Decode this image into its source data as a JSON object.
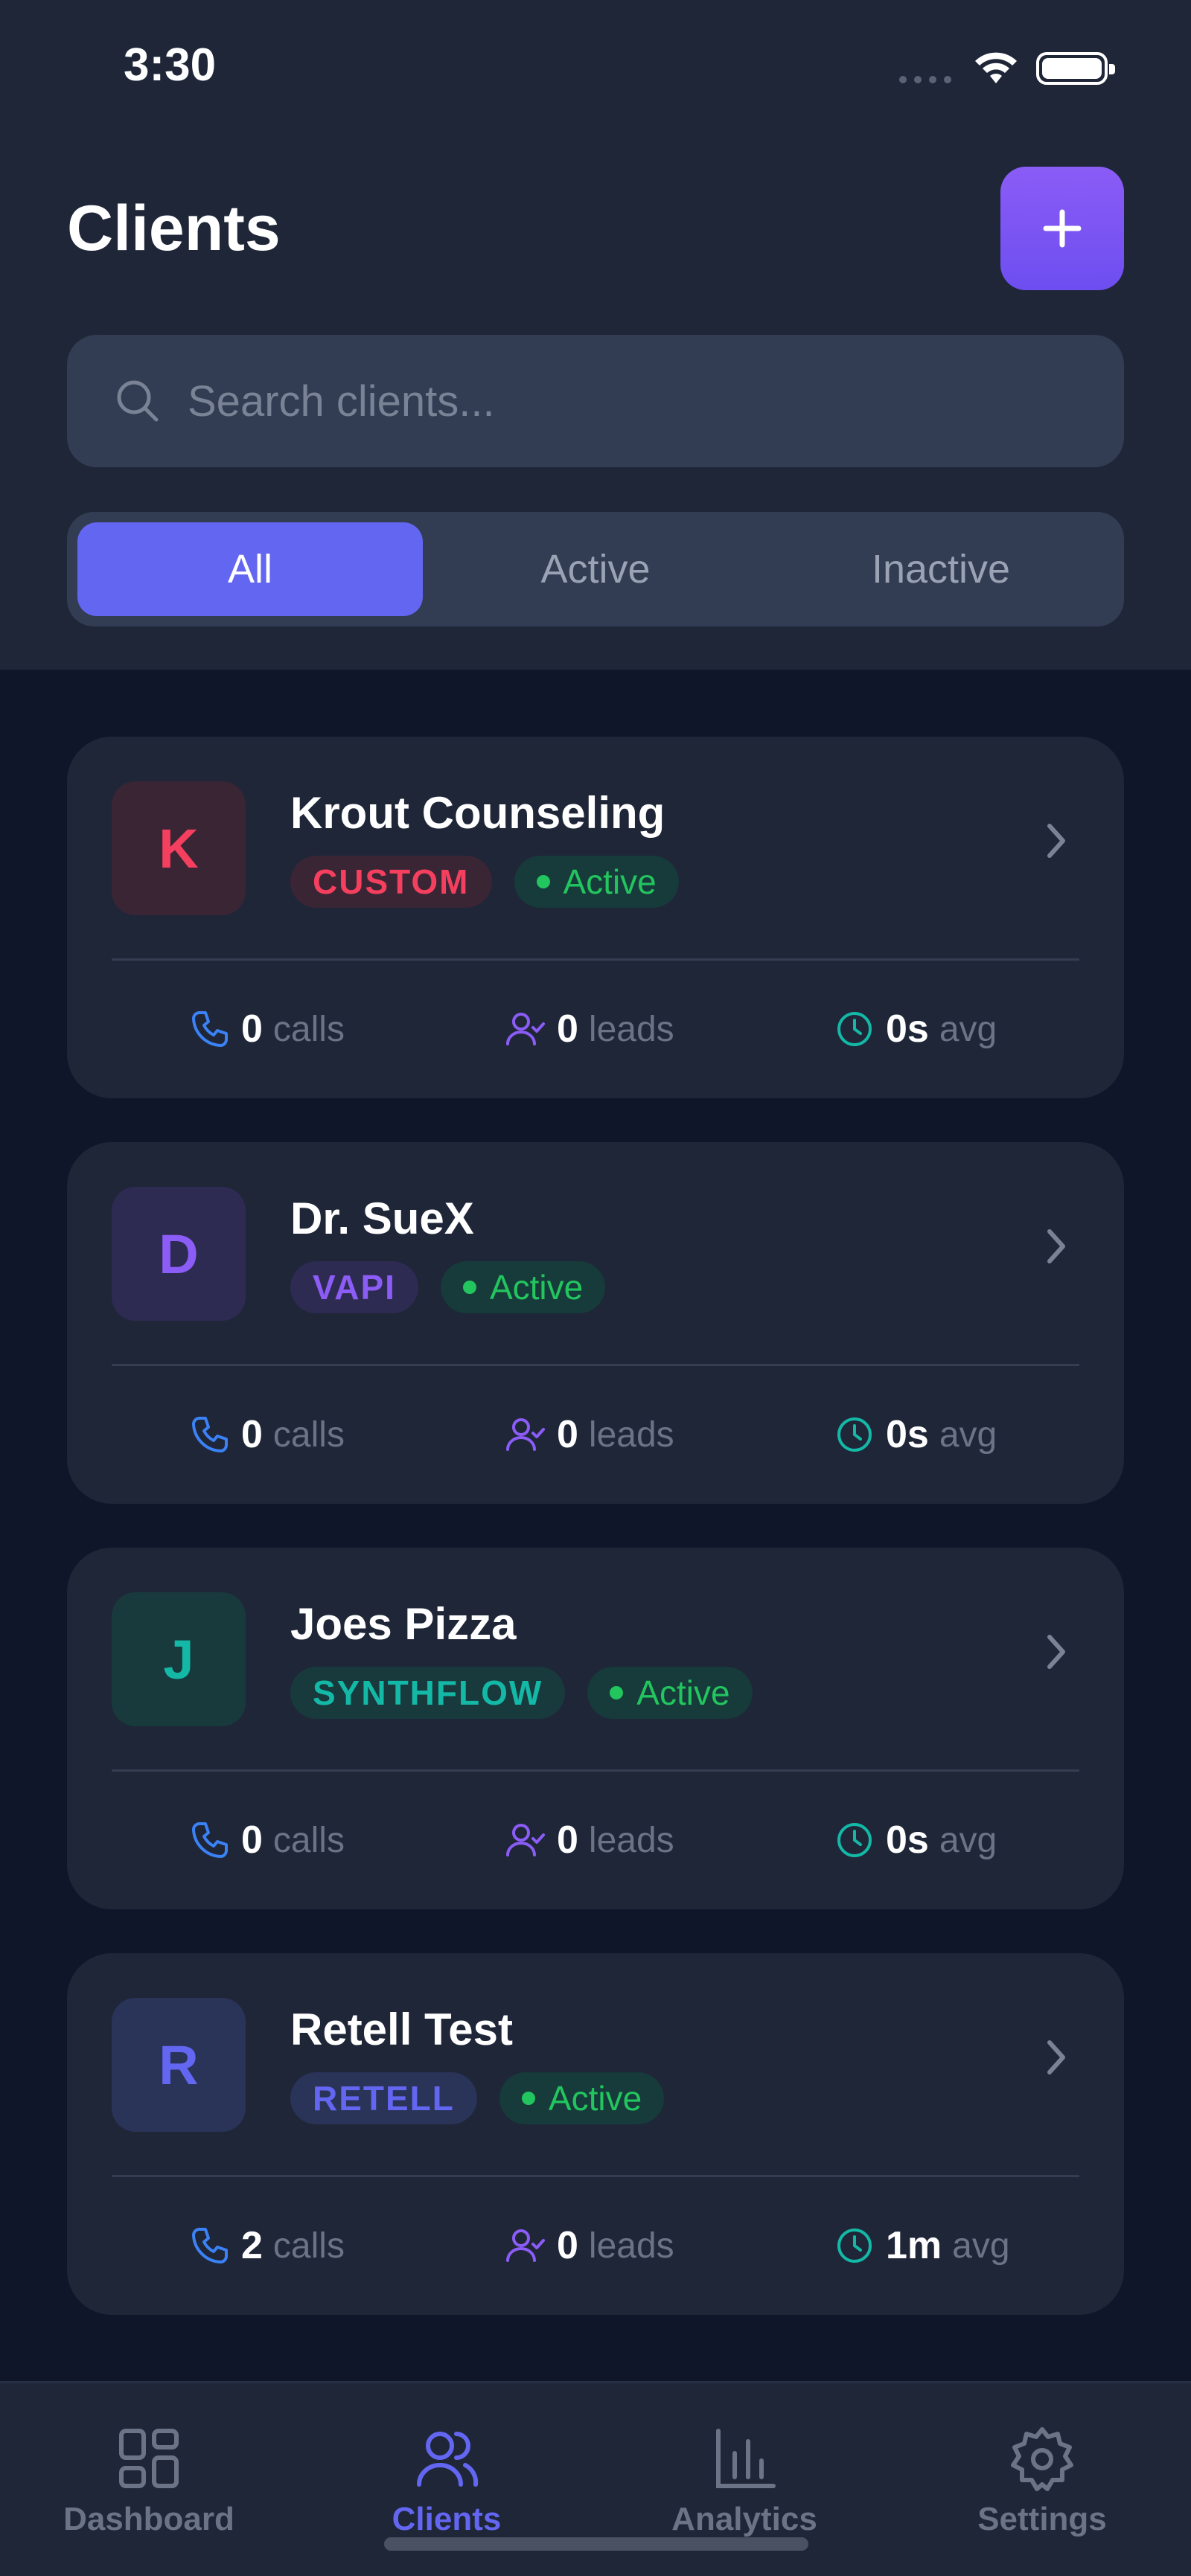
{
  "status_bar": {
    "time": "3:30"
  },
  "header": {
    "title": "Clients",
    "add_label": "+"
  },
  "search": {
    "placeholder": "Search clients..."
  },
  "filters": [
    {
      "label": "All",
      "selected": true
    },
    {
      "label": "Active",
      "selected": false
    },
    {
      "label": "Inactive",
      "selected": false
    }
  ],
  "clients": [
    {
      "initial": "K",
      "name": "Krout Counseling",
      "provider": "CUSTOM",
      "status": "Active",
      "calls": "0",
      "calls_unit": "calls",
      "leads": "0",
      "leads_unit": "leads",
      "avg": "0s",
      "avg_unit": "avg",
      "colors": {
        "avatar_bg": "#3a2535",
        "avatar_fg": "#f43f5e",
        "tag_bg": "#3a2535",
        "tag_fg": "#f43f5e"
      }
    },
    {
      "initial": "D",
      "name": "Dr. SueX",
      "provider": "VAPI",
      "status": "Active",
      "calls": "0",
      "calls_unit": "calls",
      "leads": "0",
      "leads_unit": "leads",
      "avg": "0s",
      "avg_unit": "avg",
      "colors": {
        "avatar_bg": "#2e2b52",
        "avatar_fg": "#8b5cf6",
        "tag_bg": "#2e2b52",
        "tag_fg": "#8b5cf6"
      }
    },
    {
      "initial": "J",
      "name": "Joes Pizza",
      "provider": "SYNTHFLOW",
      "status": "Active",
      "calls": "0",
      "calls_unit": "calls",
      "leads": "0",
      "leads_unit": "leads",
      "avg": "0s",
      "avg_unit": "avg",
      "colors": {
        "avatar_bg": "#183a3d",
        "avatar_fg": "#14b8a6",
        "tag_bg": "#183a3d",
        "tag_fg": "#14b8a6"
      }
    },
    {
      "initial": "R",
      "name": "Retell Test",
      "provider": "RETELL",
      "status": "Active",
      "calls": "2",
      "calls_unit": "calls",
      "leads": "0",
      "leads_unit": "leads",
      "avg": "1m",
      "avg_unit": "avg",
      "colors": {
        "avatar_bg": "#2a3358",
        "avatar_fg": "#6366f1",
        "tag_bg": "#2a3358",
        "tag_fg": "#6366f1"
      }
    }
  ],
  "tabs": [
    {
      "label": "Dashboard",
      "icon": "grid-icon",
      "active": false
    },
    {
      "label": "Clients",
      "icon": "users-icon",
      "active": true
    },
    {
      "label": "Analytics",
      "icon": "bar-chart-icon",
      "active": false
    },
    {
      "label": "Settings",
      "icon": "gear-icon",
      "active": false
    }
  ],
  "colors": {
    "accent": "#6366f1",
    "status_green": "#22c55e",
    "phone": "#3b82f6",
    "lead": "#8b5cf6",
    "clock": "#14b8a6"
  }
}
